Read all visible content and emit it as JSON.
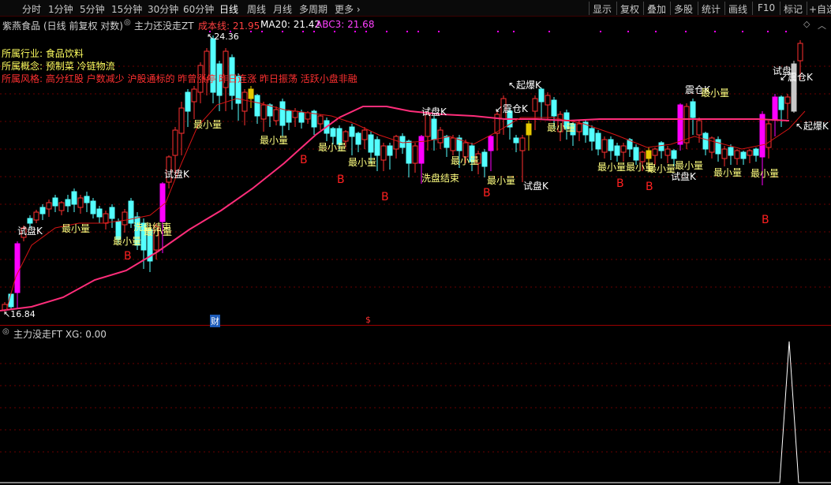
{
  "toolbar": {
    "left": [
      "分时",
      "1分钟",
      "5分钟",
      "15分钟",
      "30分钟",
      "60分钟",
      "日线",
      "周线",
      "月线",
      "多周期",
      "更多 ›"
    ],
    "active_index": 6,
    "right": [
      "显示",
      "复权",
      "叠加",
      "多股",
      "统计",
      "画线",
      "F10",
      "标记",
      "+自选"
    ]
  },
  "main": {
    "stock_name": "紫燕食品",
    "chart_mode": "(日线 前复权 对数)",
    "indicator_name": "主力还没走ZT",
    "cost_line_label": "成本线: 21.95",
    "ma20_label": "MA20: 21.42",
    "abc3_label": "ABC3: 21.68",
    "industry": "所属行业: 食品饮料",
    "concept": "所属概念: 预制菜 冷链物流",
    "style": "所属风格: 高分红股 户数减少 沪股通标的 昨曾涨停 昨日连涨 昨日振荡 活跃小盘非融",
    "high_price": "24.36",
    "low_price": "16.84",
    "cai_marker": "财",
    "dollar_marker": "$",
    "colors": {
      "up": "#ff3030",
      "down": "#54ffff",
      "ma": "#ff2d7a",
      "ma_thin": "#d41414",
      "pink_bar": "#ff00ff",
      "yellow_bar": "#e6c800"
    }
  },
  "annotations": [
    {
      "text": "试盘K",
      "color": "#ffffff"
    },
    {
      "text": "最小量",
      "color": "#ffff80"
    },
    {
      "text": "最小量",
      "color": "#ffff80"
    },
    {
      "text": "洗盘结束",
      "color": "#ffff80"
    },
    {
      "text": "最小量",
      "color": "#ffff80"
    },
    {
      "text": "试盘K",
      "color": "#ffffff"
    },
    {
      "text": "最小量",
      "color": "#ffff80"
    },
    {
      "text": "最小量",
      "color": "#ffff80"
    },
    {
      "text": "最小量",
      "color": "#ffff80"
    },
    {
      "text": "最小量",
      "color": "#ffff80"
    },
    {
      "text": "试盘K",
      "color": "#ffffff"
    },
    {
      "text": "洗盘结束",
      "color": "#ffff80"
    },
    {
      "text": "最小量",
      "color": "#ffff80"
    },
    {
      "text": "最小量",
      "color": "#ffff80"
    },
    {
      "text": "试盘K",
      "color": "#ffffff"
    },
    {
      "text": "↙震仓K",
      "color": "#ffffff"
    },
    {
      "text": "↖起爆K",
      "color": "#ffffff"
    },
    {
      "text": "最小量",
      "color": "#ffff80"
    },
    {
      "text": "最小量",
      "color": "#ffff80"
    },
    {
      "text": "最小量",
      "color": "#ffff80"
    },
    {
      "text": "试盘K",
      "color": "#ffffff"
    },
    {
      "text": "震仓K",
      "color": "#ffffff"
    },
    {
      "text": "最小量",
      "color": "#ffff80"
    },
    {
      "text": "最小量",
      "color": "#ffff80"
    },
    {
      "text": "最小量",
      "color": "#ffff80"
    },
    {
      "text": "最小量",
      "color": "#ffff80"
    },
    {
      "text": "最小量",
      "color": "#ffff80"
    },
    {
      "text": "试盘",
      "color": "#ffffff"
    },
    {
      "text": "↙震仓K",
      "color": "#ffffff"
    },
    {
      "text": "↖起爆K",
      "color": "#ffffff"
    },
    {
      "text": "B",
      "color": "#ff2020"
    }
  ],
  "sub": {
    "indicator_label": "主力没走FT XG: 0.00"
  }
}
